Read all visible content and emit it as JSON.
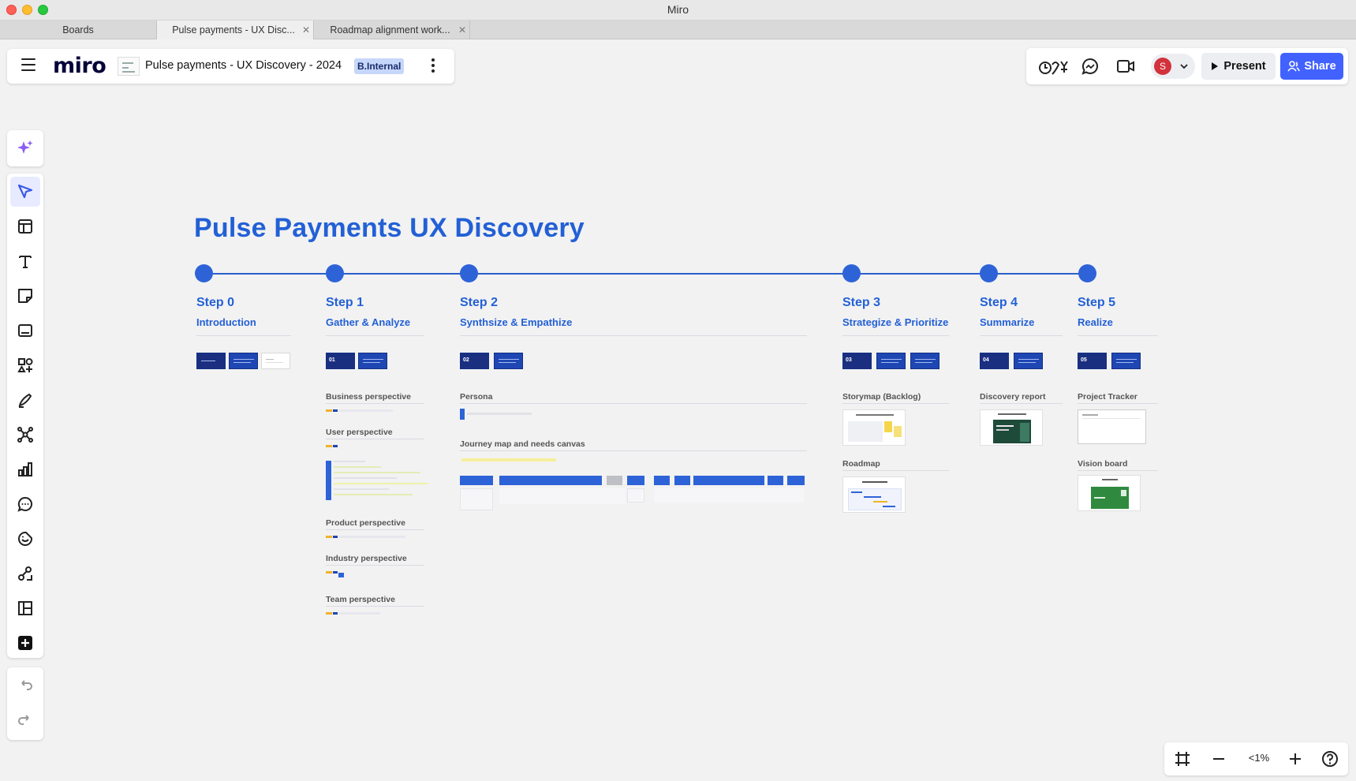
{
  "window": {
    "title": "Miro"
  },
  "tabs": [
    {
      "label": "Boards",
      "active": false,
      "closable": false
    },
    {
      "label": "Pulse payments - UX Disc...",
      "active": true,
      "closable": true
    },
    {
      "label": "Roadmap alignment work...",
      "active": false,
      "closable": true
    }
  ],
  "header": {
    "logo": "miro",
    "board_title": "Pulse payments - UX Discovery - 2024",
    "badge": "B.Internal"
  },
  "toolbar_right": {
    "avatar_initial": "S",
    "present_label": "Present",
    "share_label": "Share",
    "accent": "#4262ff"
  },
  "left_tools": [
    "ai-sparkle-icon",
    "select-cursor-icon",
    "templates-icon",
    "text-icon",
    "sticky-note-icon",
    "card-icon",
    "shapes-icon",
    "pen-icon",
    "mind-map-icon",
    "chart-icon",
    "comment-icon",
    "emoji-sticker-icon",
    "diagram-icon",
    "frames-icon",
    "more-apps-icon"
  ],
  "zoom": {
    "level": "<1%"
  },
  "board": {
    "heading": "Pulse Payments UX Discovery",
    "heading_color": "#2360d6",
    "steps": [
      {
        "num": "Step 0",
        "name": "Introduction"
      },
      {
        "num": "Step 1",
        "name": "Gather & Analyze"
      },
      {
        "num": "Step 2",
        "name": "Synthsize & Empathize"
      },
      {
        "num": "Step 3",
        "name": "Strategize & Prioritize"
      },
      {
        "num": "Step 4",
        "name": "Summarize"
      },
      {
        "num": "Step 5",
        "name": "Realize"
      }
    ],
    "step1_sections": [
      "Business perspective",
      "User perspective",
      "Product perspective",
      "Industry perspective",
      "Team perspective"
    ],
    "step2_sections": [
      "Persona",
      "Journey map and needs canvas"
    ],
    "step3_sections": [
      "Storymap (Backlog)",
      "Roadmap"
    ],
    "step4_sections": [
      "Discovery report"
    ],
    "step5_sections": [
      "Project Tracker",
      "Vision board"
    ],
    "slide_numbers": [
      "01",
      "02",
      "03",
      "04",
      "05"
    ]
  }
}
